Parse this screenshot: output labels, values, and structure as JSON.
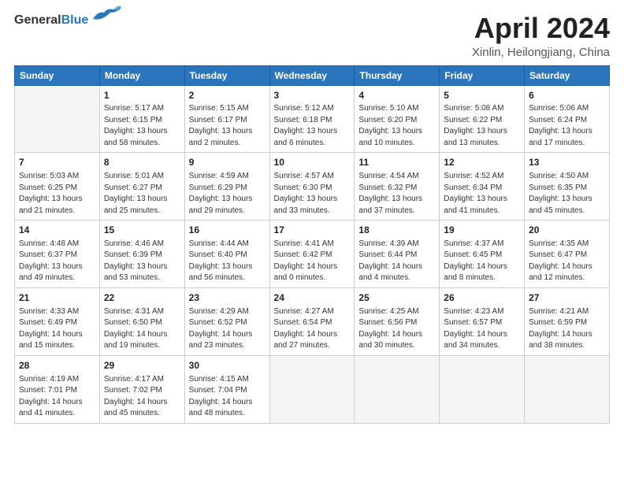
{
  "header": {
    "logo_general": "General",
    "logo_blue": "Blue",
    "title": "April 2024",
    "subtitle": "Xinlin, Heilongjiang, China"
  },
  "days_of_week": [
    "Sunday",
    "Monday",
    "Tuesday",
    "Wednesday",
    "Thursday",
    "Friday",
    "Saturday"
  ],
  "weeks": [
    [
      {
        "day": "",
        "empty": true
      },
      {
        "day": "1",
        "sunrise": "Sunrise: 5:17 AM",
        "sunset": "Sunset: 6:15 PM",
        "daylight": "Daylight: 13 hours and 58 minutes."
      },
      {
        "day": "2",
        "sunrise": "Sunrise: 5:15 AM",
        "sunset": "Sunset: 6:17 PM",
        "daylight": "Daylight: 13 hours and 2 minutes."
      },
      {
        "day": "3",
        "sunrise": "Sunrise: 5:12 AM",
        "sunset": "Sunset: 6:18 PM",
        "daylight": "Daylight: 13 hours and 6 minutes."
      },
      {
        "day": "4",
        "sunrise": "Sunrise: 5:10 AM",
        "sunset": "Sunset: 6:20 PM",
        "daylight": "Daylight: 13 hours and 10 minutes."
      },
      {
        "day": "5",
        "sunrise": "Sunrise: 5:08 AM",
        "sunset": "Sunset: 6:22 PM",
        "daylight": "Daylight: 13 hours and 13 minutes."
      },
      {
        "day": "6",
        "sunrise": "Sunrise: 5:06 AM",
        "sunset": "Sunset: 6:24 PM",
        "daylight": "Daylight: 13 hours and 17 minutes."
      }
    ],
    [
      {
        "day": "7",
        "sunrise": "Sunrise: 5:03 AM",
        "sunset": "Sunset: 6:25 PM",
        "daylight": "Daylight: 13 hours and 21 minutes."
      },
      {
        "day": "8",
        "sunrise": "Sunrise: 5:01 AM",
        "sunset": "Sunset: 6:27 PM",
        "daylight": "Daylight: 13 hours and 25 minutes."
      },
      {
        "day": "9",
        "sunrise": "Sunrise: 4:59 AM",
        "sunset": "Sunset: 6:29 PM",
        "daylight": "Daylight: 13 hours and 29 minutes."
      },
      {
        "day": "10",
        "sunrise": "Sunrise: 4:57 AM",
        "sunset": "Sunset: 6:30 PM",
        "daylight": "Daylight: 13 hours and 33 minutes."
      },
      {
        "day": "11",
        "sunrise": "Sunrise: 4:54 AM",
        "sunset": "Sunset: 6:32 PM",
        "daylight": "Daylight: 13 hours and 37 minutes."
      },
      {
        "day": "12",
        "sunrise": "Sunrise: 4:52 AM",
        "sunset": "Sunset: 6:34 PM",
        "daylight": "Daylight: 13 hours and 41 minutes."
      },
      {
        "day": "13",
        "sunrise": "Sunrise: 4:50 AM",
        "sunset": "Sunset: 6:35 PM",
        "daylight": "Daylight: 13 hours and 45 minutes."
      }
    ],
    [
      {
        "day": "14",
        "sunrise": "Sunrise: 4:48 AM",
        "sunset": "Sunset: 6:37 PM",
        "daylight": "Daylight: 13 hours and 49 minutes."
      },
      {
        "day": "15",
        "sunrise": "Sunrise: 4:46 AM",
        "sunset": "Sunset: 6:39 PM",
        "daylight": "Daylight: 13 hours and 53 minutes."
      },
      {
        "day": "16",
        "sunrise": "Sunrise: 4:44 AM",
        "sunset": "Sunset: 6:40 PM",
        "daylight": "Daylight: 13 hours and 56 minutes."
      },
      {
        "day": "17",
        "sunrise": "Sunrise: 4:41 AM",
        "sunset": "Sunset: 6:42 PM",
        "daylight": "Daylight: 14 hours and 0 minutes."
      },
      {
        "day": "18",
        "sunrise": "Sunrise: 4:39 AM",
        "sunset": "Sunset: 6:44 PM",
        "daylight": "Daylight: 14 hours and 4 minutes."
      },
      {
        "day": "19",
        "sunrise": "Sunrise: 4:37 AM",
        "sunset": "Sunset: 6:45 PM",
        "daylight": "Daylight: 14 hours and 8 minutes."
      },
      {
        "day": "20",
        "sunrise": "Sunrise: 4:35 AM",
        "sunset": "Sunset: 6:47 PM",
        "daylight": "Daylight: 14 hours and 12 minutes."
      }
    ],
    [
      {
        "day": "21",
        "sunrise": "Sunrise: 4:33 AM",
        "sunset": "Sunset: 6:49 PM",
        "daylight": "Daylight: 14 hours and 15 minutes."
      },
      {
        "day": "22",
        "sunrise": "Sunrise: 4:31 AM",
        "sunset": "Sunset: 6:50 PM",
        "daylight": "Daylight: 14 hours and 19 minutes."
      },
      {
        "day": "23",
        "sunrise": "Sunrise: 4:29 AM",
        "sunset": "Sunset: 6:52 PM",
        "daylight": "Daylight: 14 hours and 23 minutes."
      },
      {
        "day": "24",
        "sunrise": "Sunrise: 4:27 AM",
        "sunset": "Sunset: 6:54 PM",
        "daylight": "Daylight: 14 hours and 27 minutes."
      },
      {
        "day": "25",
        "sunrise": "Sunrise: 4:25 AM",
        "sunset": "Sunset: 6:56 PM",
        "daylight": "Daylight: 14 hours and 30 minutes."
      },
      {
        "day": "26",
        "sunrise": "Sunrise: 4:23 AM",
        "sunset": "Sunset: 6:57 PM",
        "daylight": "Daylight: 14 hours and 34 minutes."
      },
      {
        "day": "27",
        "sunrise": "Sunrise: 4:21 AM",
        "sunset": "Sunset: 6:59 PM",
        "daylight": "Daylight: 14 hours and 38 minutes."
      }
    ],
    [
      {
        "day": "28",
        "sunrise": "Sunrise: 4:19 AM",
        "sunset": "Sunset: 7:01 PM",
        "daylight": "Daylight: 14 hours and 41 minutes."
      },
      {
        "day": "29",
        "sunrise": "Sunrise: 4:17 AM",
        "sunset": "Sunset: 7:02 PM",
        "daylight": "Daylight: 14 hours and 45 minutes."
      },
      {
        "day": "30",
        "sunrise": "Sunrise: 4:15 AM",
        "sunset": "Sunset: 7:04 PM",
        "daylight": "Daylight: 14 hours and 48 minutes."
      },
      {
        "day": "",
        "empty": true
      },
      {
        "day": "",
        "empty": true
      },
      {
        "day": "",
        "empty": true
      },
      {
        "day": "",
        "empty": true
      }
    ]
  ]
}
